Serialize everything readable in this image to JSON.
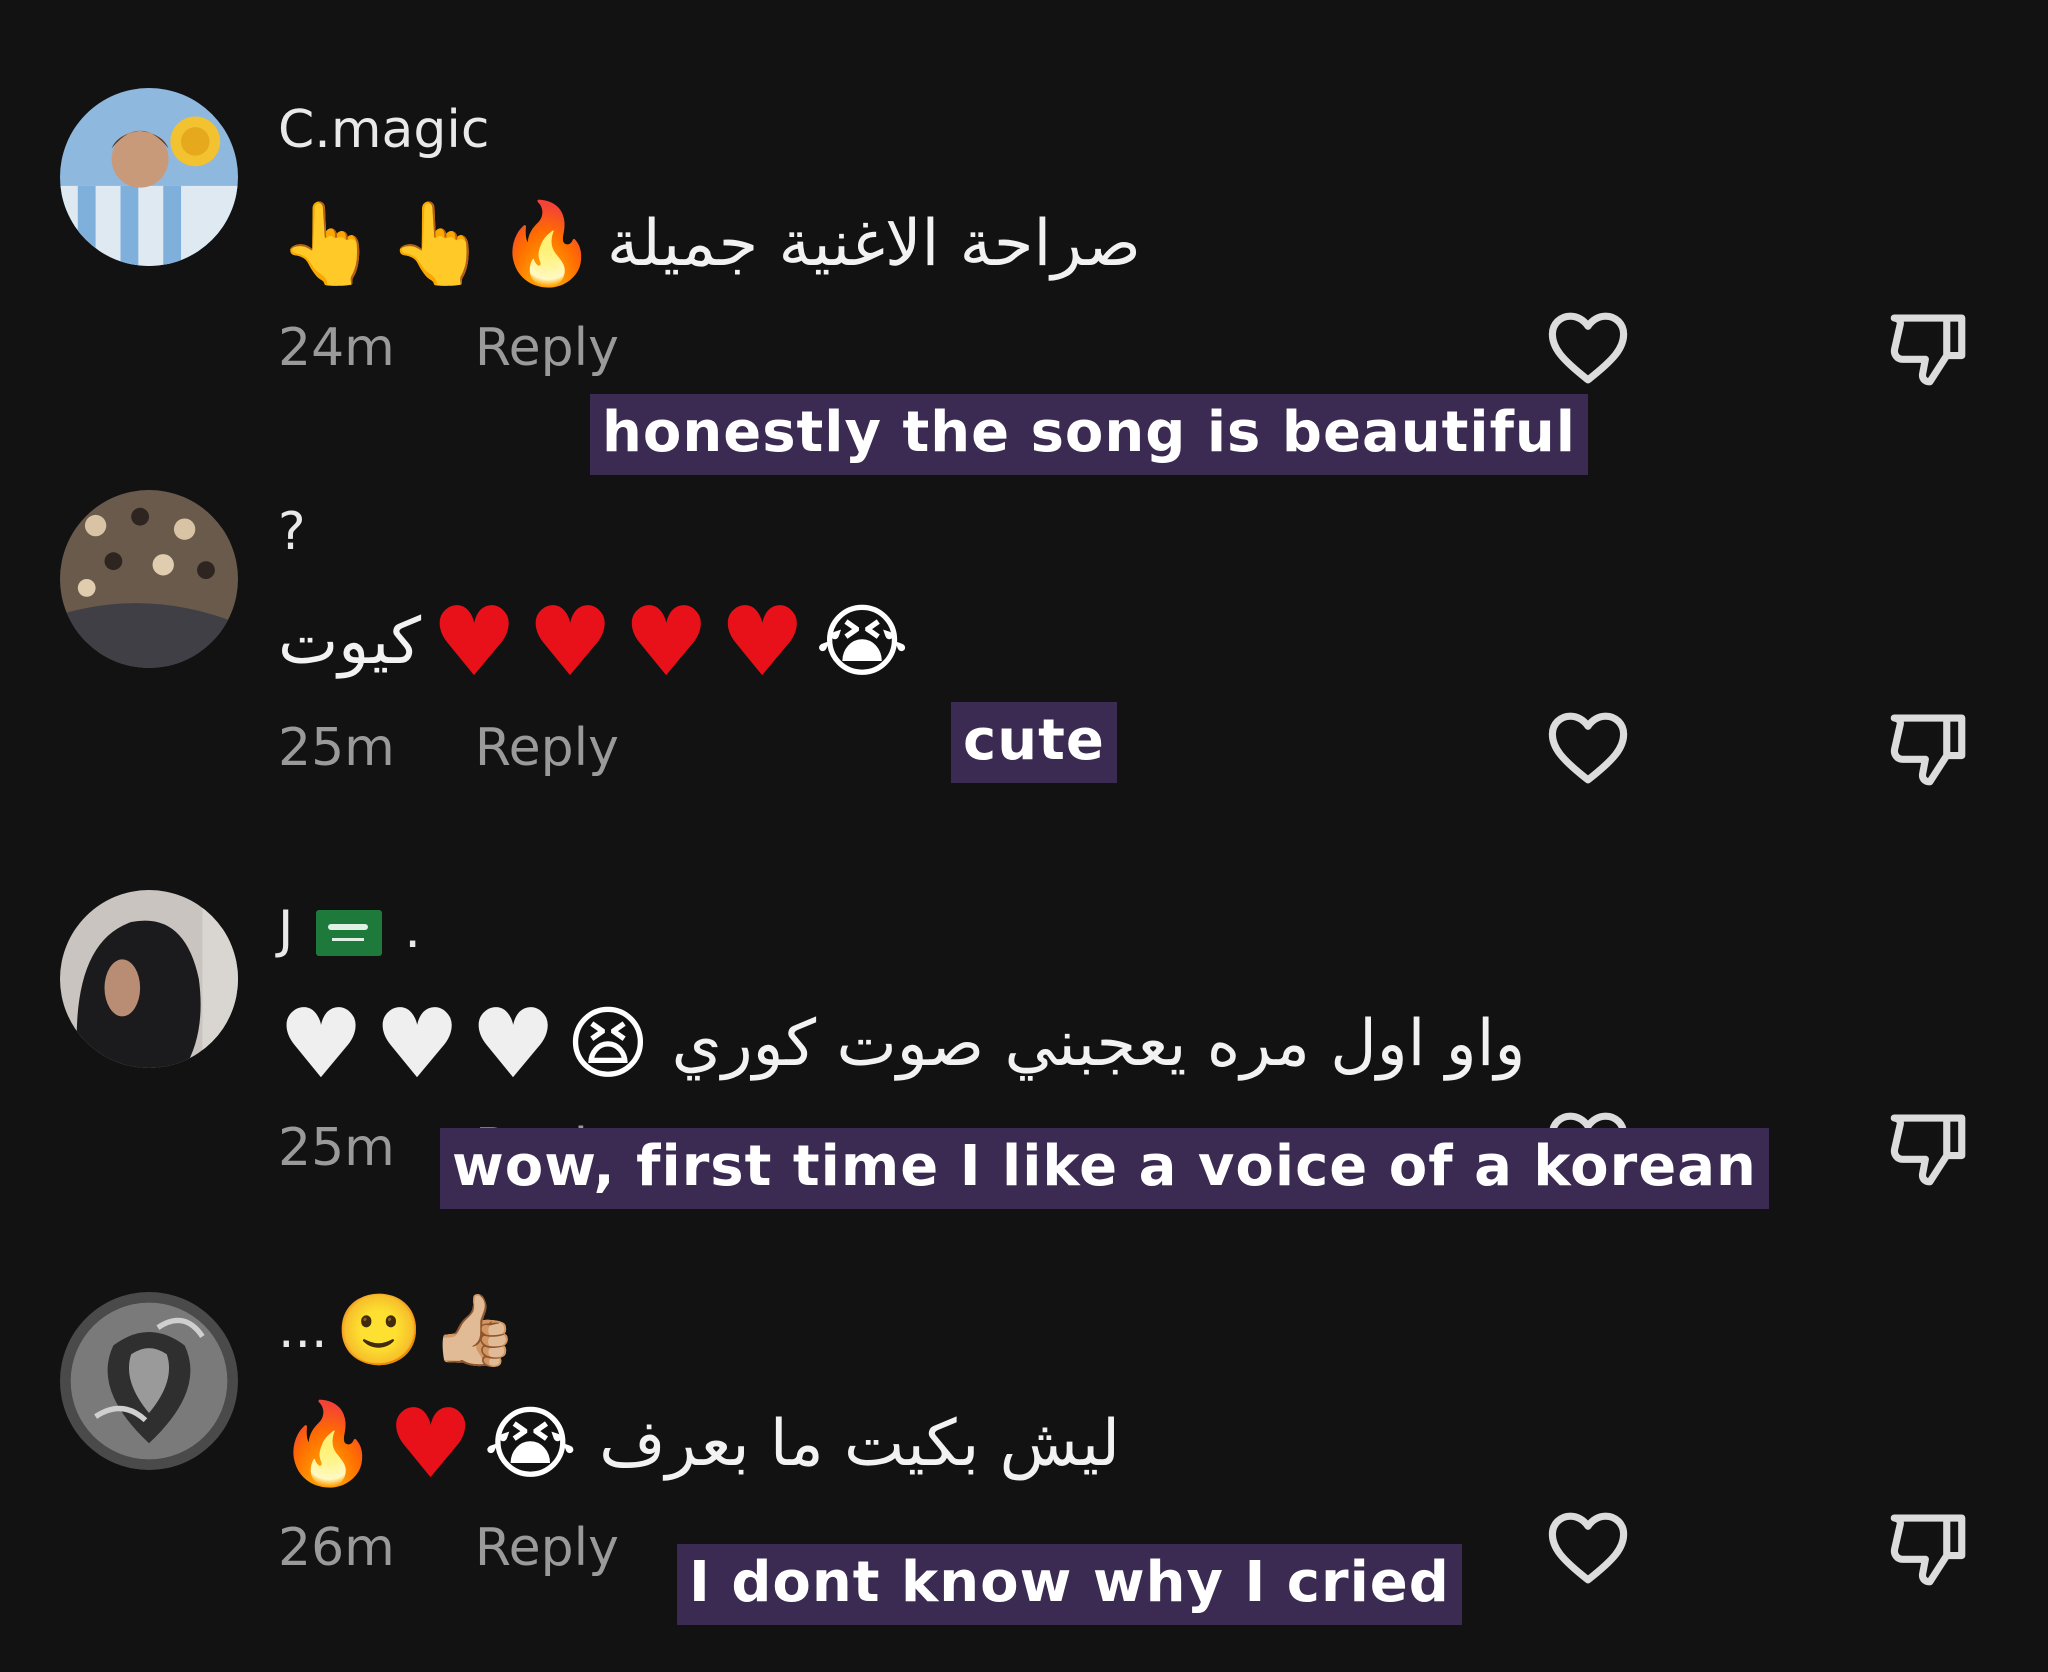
{
  "comments": [
    {
      "username": "C.magic",
      "body_text": "صراحة الاغنية جميلة",
      "emojis": [
        "🔥",
        "👆",
        "👆"
      ],
      "time": "24m",
      "reply_label": "Reply",
      "caption": "honestly the song is beautiful"
    },
    {
      "username": "?",
      "body_text": "كيوت",
      "emojis": [
        "❤️",
        "❤️",
        "❤️",
        "❤️",
        "😭"
      ],
      "time": "25m",
      "reply_label": "Reply",
      "caption": "cute"
    },
    {
      "username": "J",
      "username_suffix": ".",
      "body_text": "واو اول مره يعجبني صوت كوري",
      "emojis": [
        "😫",
        "🤍",
        "🤍",
        "🤍"
      ],
      "time": "25m",
      "reply_label": "Reply",
      "caption": "wow, first time I like a voice of a korean"
    },
    {
      "username": "...",
      "username_emojis": [
        "🙂",
        "👍🏼"
      ],
      "body_text": "ليش بكيت ما بعرف",
      "emojis": [
        "😭",
        "❤️",
        "🔥"
      ],
      "time": "26m",
      "reply_label": "Reply",
      "caption": "I dont know why I cried"
    }
  ],
  "icons": {
    "like": "heart-outline-icon",
    "dislike": "thumbs-down-outline-icon"
  },
  "colors": {
    "background": "#121212",
    "caption_bg": "#3b2a51",
    "meta_text": "#9a9a9a"
  }
}
